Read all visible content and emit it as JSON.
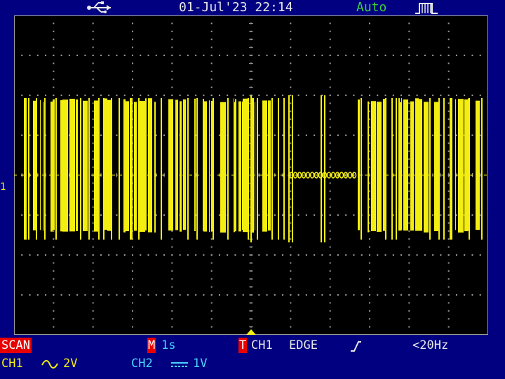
{
  "status": {
    "datetime": "01-Jul'23 22:14",
    "trigger_mode": "Auto",
    "usb_icon": "usb-icon",
    "trigger_status_icon": "trigger-running-icon"
  },
  "waveform": {
    "channel_marker": "1",
    "trace_color": "#f3ee10",
    "grid_color": "#9a9a9a"
  },
  "bottom": {
    "mode": "SCAN",
    "timebase_prefix": "M",
    "timebase": "1s",
    "trigger_prefix": "T",
    "trigger_source": "CH1",
    "trigger_type": "EDGE",
    "trigger_slope_icon": "rising-edge-icon",
    "trigger_frequency": "<20Hz",
    "ch1_label": "CH1",
    "ch1_coupling_icon": "ac-coupling-icon",
    "ch1_scale": "2V",
    "ch2_label": "CH2",
    "ch2_coupling_icon": "dc-coupling-icon",
    "ch2_scale": "1V"
  },
  "colors": {
    "ch1": "#f3ee10",
    "ch2": "#4bd4ff",
    "accent_red": "#e80000",
    "panel_blue": "#000080",
    "trigger_mode_green": "#3cd23c"
  }
}
